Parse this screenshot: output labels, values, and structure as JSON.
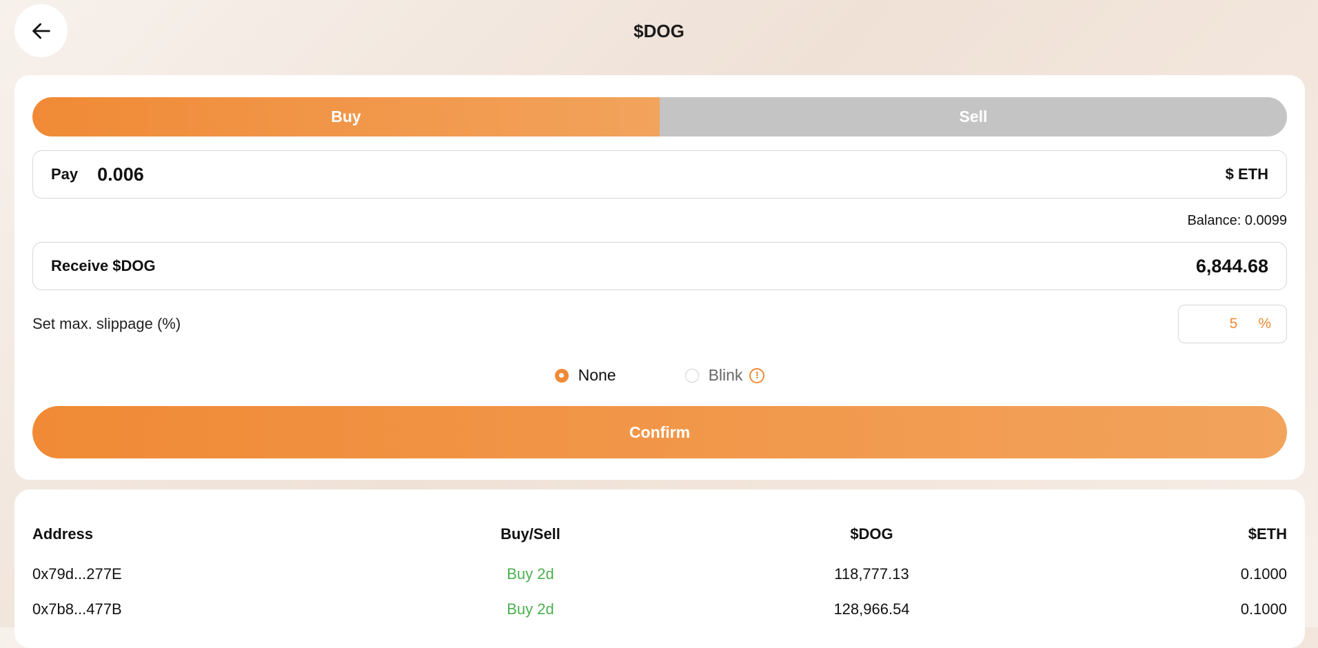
{
  "header": {
    "title": "$DOG",
    "back_icon": "arrow-left-icon"
  },
  "trade": {
    "tabs": [
      {
        "label": "Buy",
        "active": true
      },
      {
        "label": "Sell",
        "active": false
      }
    ],
    "pay": {
      "label": "Pay",
      "value": "0.006",
      "unit": "$ ETH"
    },
    "balance": "Balance: 0.0099",
    "receive": {
      "label": "Receive $DOG",
      "value": "6,844.68"
    },
    "slippage": {
      "label": "Set max. slippage (%)",
      "value": "5",
      "unit": "%"
    },
    "mev_options": [
      {
        "label": "None",
        "selected": true
      },
      {
        "label": "Blink",
        "selected": false,
        "icon": "warning-icon",
        "icon_text": "!"
      }
    ],
    "confirm_label": "Confirm",
    "accent_color": "#f08a36"
  },
  "history": {
    "columns": [
      "Address",
      "Buy/Sell",
      "$DOG",
      "$ETH"
    ],
    "rows": [
      {
        "address": "0x79d...277E",
        "side": "Buy 2d",
        "dog": "118,777.13",
        "eth": "0.1000"
      },
      {
        "address": "0x7b8...477B",
        "side": "Buy 2d",
        "dog": "128,966.54",
        "eth": "0.1000"
      }
    ],
    "buy_color": "#4caf50"
  }
}
